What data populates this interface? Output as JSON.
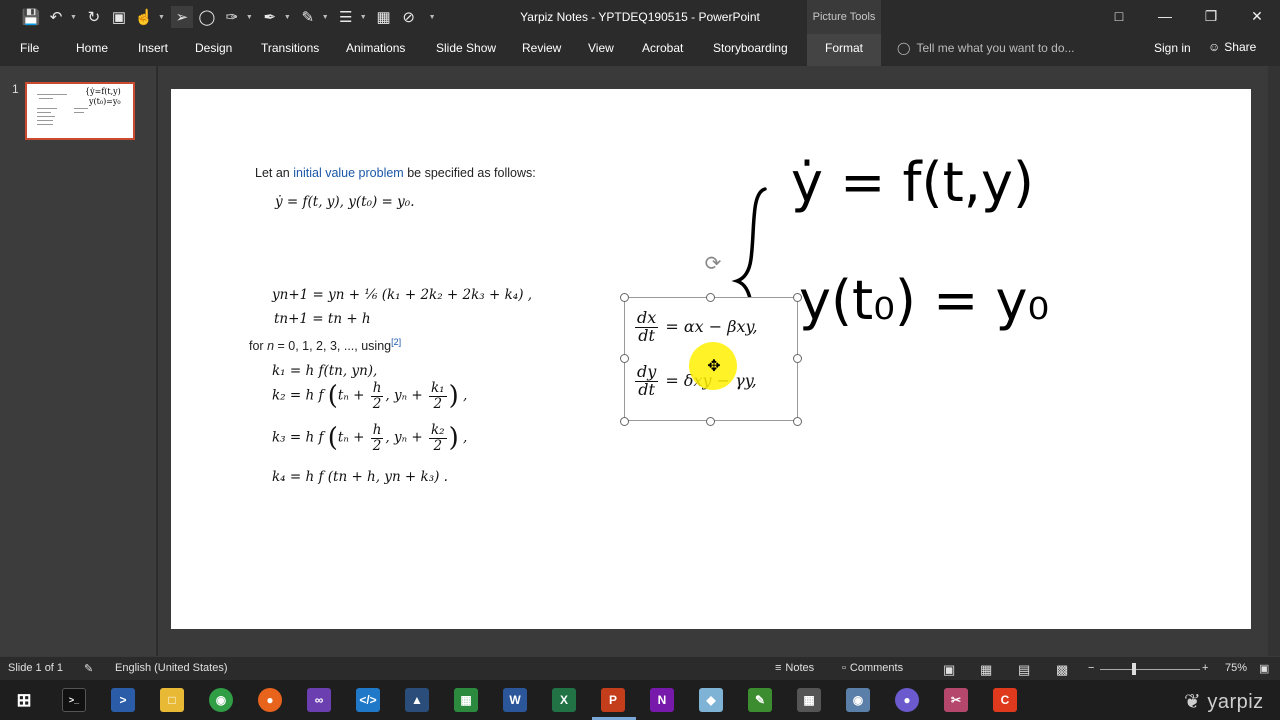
{
  "window": {
    "title": "Yarpiz Notes - YPTDEQ190515 - PowerPoint",
    "context_tool": "Picture Tools"
  },
  "ribbon": {
    "tabs": [
      {
        "label": "File"
      },
      {
        "label": "Home"
      },
      {
        "label": "Insert"
      },
      {
        "label": "Design"
      },
      {
        "label": "Transitions"
      },
      {
        "label": "Animations"
      },
      {
        "label": "Slide Show"
      },
      {
        "label": "Review"
      },
      {
        "label": "View"
      },
      {
        "label": "Acrobat"
      },
      {
        "label": "Storyboarding"
      },
      {
        "label": "Format"
      }
    ],
    "active_tab": "Format",
    "tell_me_placeholder": "Tell me what you want to do...",
    "sign_in": "Sign in",
    "share": "Share"
  },
  "thumbnails": {
    "slide_number": "1"
  },
  "slide": {
    "intro": {
      "prefix": "Let an ",
      "link": "initial value problem",
      "suffix": " be specified as follows:"
    },
    "ivp_equation": "ẏ = f(t, y),    y(t₀) = y₀.",
    "rk4": {
      "line1": "yn+1 = yn + ⅙ (k₁ + 2k₂ + 2k₃ + k₄) ,",
      "line2": "tn+1 = tn + h",
      "for_prefix": "for ",
      "for_var": "n",
      "for_suffix": " = 0, 1, 2, 3, ..., using",
      "for_ref": "[2]",
      "k1": "k₁ = h f(tn, yn),",
      "k4": "k₄ = h f (tn + h, yn + k₃) ."
    },
    "lotka_volterra": {
      "eq1_rhs": "= αx − βxy,",
      "eq2_rhs": "= δxy − γy,"
    },
    "handwriting": {
      "line1": "ẏ = f(t,y)",
      "line2": "y(t₀) = y₀"
    }
  },
  "statusbar": {
    "slide_info": "Slide 1 of 1",
    "language": "English (United States)",
    "notes": "Notes",
    "comments": "Comments",
    "zoom": "75%"
  },
  "taskbar": {
    "brand": "yarpiz"
  },
  "colors": {
    "ui_dark": "#2b2b2b",
    "link_blue": "#1a57a8",
    "thumb_border": "#c94a2e",
    "cursor_highlight": "#fff000"
  }
}
